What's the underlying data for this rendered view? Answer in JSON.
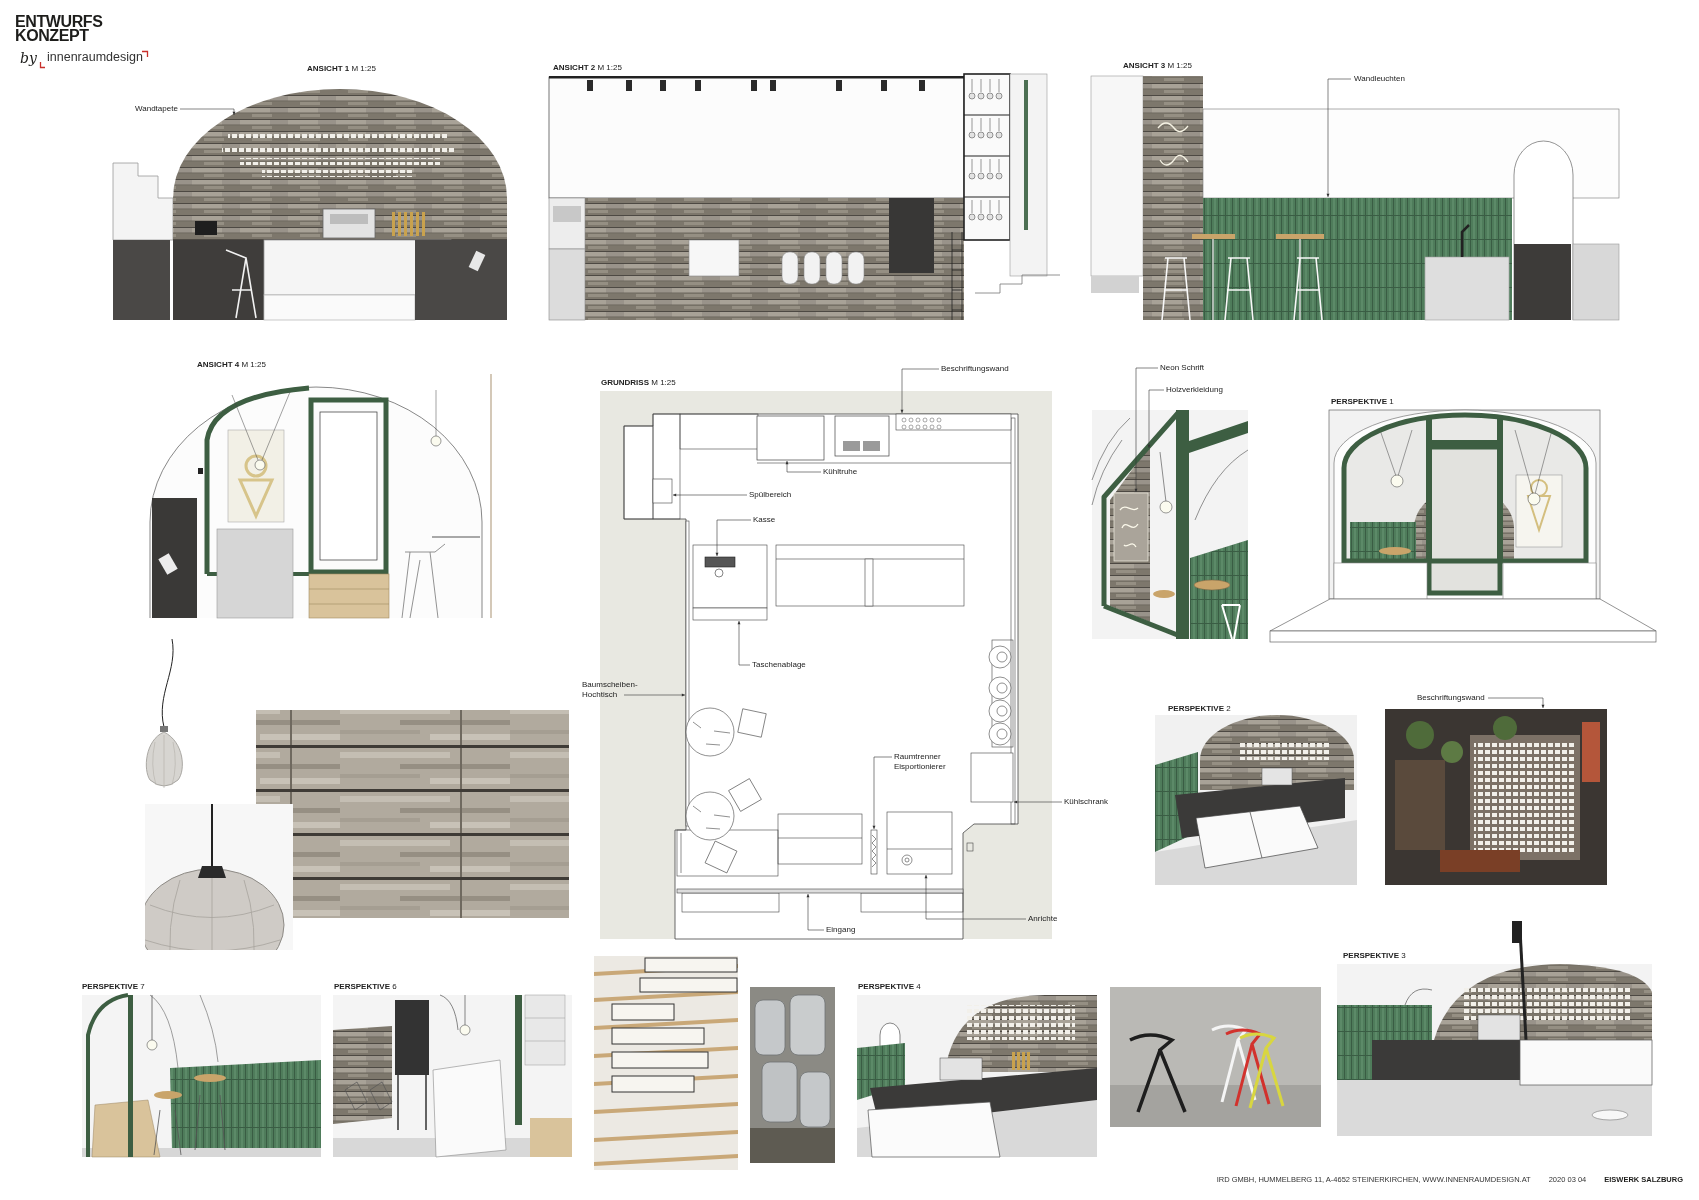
{
  "header": {
    "title_lines": [
      "ENTWURFS",
      "KONZEPT"
    ],
    "byline": "by",
    "brand": "innenraumdesign"
  },
  "ansicht_1": {
    "title": "**ANSICHT 1** M 1:25",
    "labels": [
      "Wandtapete"
    ]
  },
  "ansicht_2": {
    "title": "**ANSICHT 2** M 1:25"
  },
  "ansicht_3": {
    "title": "**ANSICHT 3** M 1:25",
    "labels": [
      "Wandleuchten"
    ]
  },
  "ansicht_4": {
    "title": "**ANSICHT 4** M 1:25"
  },
  "grundriss": {
    "title": "**GRUNDRISS** M 1:25",
    "labels": [
      "Beschriftungswand",
      "Kühltruhe",
      "Spülbereich",
      "Kasse",
      "Taschenablage",
      "Baumscheiben-\nHochtisch",
      "Raumtrenner\nEisportionierer",
      "Kühlschrank",
      "Anrichte",
      "Eingang"
    ]
  },
  "window_detail": {
    "labels": [
      "Neon Schrift",
      "Holzverkleidung"
    ]
  },
  "perspektive_1": {
    "title": "**PERSPEKTIVE** 1"
  },
  "perspektive_2": {
    "title": "**PERSPEKTIVE** 2"
  },
  "wall_photo": {
    "labels": [
      "Beschriftungswand"
    ]
  },
  "perspektive_7": {
    "title": "**PERSPEKTIVE** 7"
  },
  "perspektive_6": {
    "title": "**PERSPEKTIVE** 6"
  },
  "perspektive_4": {
    "title": "**PERSPEKTIVE** 4"
  },
  "perspektive_3": {
    "title": "**PERSPEKTIVE** 3"
  },
  "footer": {
    "address": "IRD GMBH, HUMMELBERG 11, A-4652 STEINERKIRCHEN, WWW.INNENRAUMDESIGN.AT",
    "date": "2020 03 04",
    "project": "EISWERK SALZBURG"
  }
}
